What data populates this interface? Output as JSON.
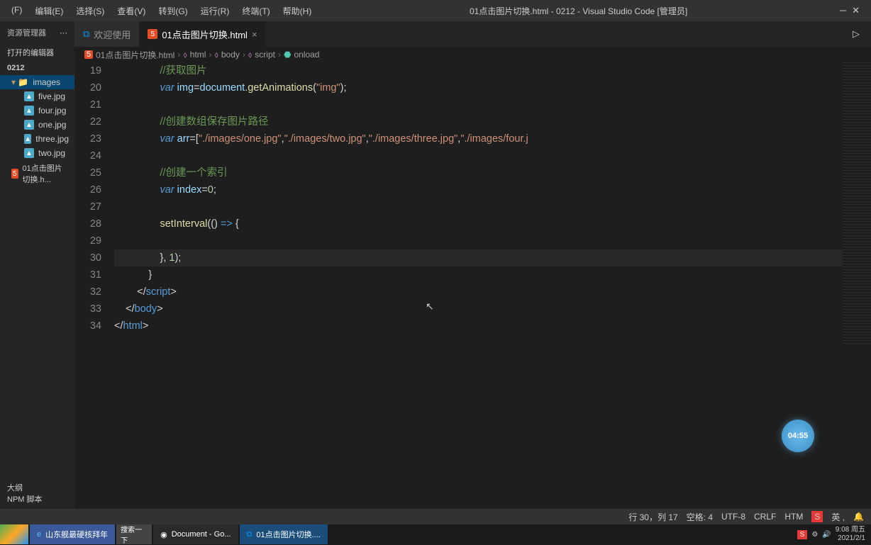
{
  "menubar": {
    "items": [
      "(F)",
      "编辑(E)",
      "选择(S)",
      "查看(V)",
      "转到(G)",
      "运行(R)",
      "终端(T)",
      "帮助(H)"
    ],
    "title": "01点击图片切换.html - 0212 - Visual Studio Code [管理员]"
  },
  "sidebar": {
    "header": "资源管理器",
    "section": "打开的编辑器",
    "root": "0212",
    "folder": "images",
    "files": [
      "five.jpg",
      "four.jpg",
      "one.jpg",
      "three.jpg",
      "two.jpg"
    ],
    "htmlFile": "01点击图片切换.h...",
    "bottom1": "大纲",
    "bottom2": "NPM 脚本"
  },
  "tabs": {
    "tab1": "欢迎使用",
    "tab2": "01点击图片切换.html"
  },
  "breadcrumb": {
    "file": "01点击图片切换.html",
    "path": [
      "html",
      "body",
      "script",
      "onload"
    ]
  },
  "code": {
    "startLine": 19,
    "lines": [
      {
        "n": 19,
        "indent": 4,
        "parts": [
          {
            "cls": "tok-cmt",
            "t": "//获取图片"
          }
        ]
      },
      {
        "n": 20,
        "indent": 4,
        "parts": [
          {
            "cls": "tok-kw",
            "t": "var"
          },
          {
            "cls": "",
            "t": " "
          },
          {
            "cls": "tok-var",
            "t": "img"
          },
          {
            "cls": "tok-op",
            "t": "="
          },
          {
            "cls": "tok-var",
            "t": "document"
          },
          {
            "cls": "tok-punct",
            "t": "."
          },
          {
            "cls": "tok-fn",
            "t": "getAnimations"
          },
          {
            "cls": "tok-punct",
            "t": "("
          },
          {
            "cls": "tok-str",
            "t": "\"img\""
          },
          {
            "cls": "tok-punct",
            "t": ");"
          }
        ]
      },
      {
        "n": 21,
        "indent": 4,
        "parts": []
      },
      {
        "n": 22,
        "indent": 4,
        "parts": [
          {
            "cls": "tok-cmt",
            "t": "//创建数组保存图片路径"
          }
        ]
      },
      {
        "n": 23,
        "indent": 4,
        "parts": [
          {
            "cls": "tok-kw",
            "t": "var"
          },
          {
            "cls": "",
            "t": " "
          },
          {
            "cls": "tok-var",
            "t": "arr"
          },
          {
            "cls": "tok-op",
            "t": "="
          },
          {
            "cls": "tok-punct",
            "t": "["
          },
          {
            "cls": "tok-str",
            "t": "\"./images/one.jpg\""
          },
          {
            "cls": "tok-punct",
            "t": ","
          },
          {
            "cls": "tok-str",
            "t": "\"./images/two.jpg\""
          },
          {
            "cls": "tok-punct",
            "t": ","
          },
          {
            "cls": "tok-str",
            "t": "\"./images/three.jpg\""
          },
          {
            "cls": "tok-punct",
            "t": ","
          },
          {
            "cls": "tok-str",
            "t": "\"./images/four.j"
          }
        ]
      },
      {
        "n": 24,
        "indent": 4,
        "parts": []
      },
      {
        "n": 25,
        "indent": 4,
        "parts": [
          {
            "cls": "tok-cmt",
            "t": "//创建一个索引"
          }
        ]
      },
      {
        "n": 26,
        "indent": 4,
        "parts": [
          {
            "cls": "tok-kw",
            "t": "var"
          },
          {
            "cls": "",
            "t": " "
          },
          {
            "cls": "tok-var",
            "t": "index"
          },
          {
            "cls": "tok-op",
            "t": "="
          },
          {
            "cls": "tok-num",
            "t": "0"
          },
          {
            "cls": "tok-punct",
            "t": ";"
          }
        ]
      },
      {
        "n": 27,
        "indent": 4,
        "parts": []
      },
      {
        "n": 28,
        "indent": 4,
        "parts": [
          {
            "cls": "tok-fn",
            "t": "setInterval"
          },
          {
            "cls": "tok-punct",
            "t": "(() "
          },
          {
            "cls": "tok-tag",
            "t": "=>"
          },
          {
            "cls": "tok-punct",
            "t": " {"
          }
        ]
      },
      {
        "n": 29,
        "indent": 5,
        "parts": []
      },
      {
        "n": 30,
        "indent": 4,
        "parts": [
          {
            "cls": "tok-punct",
            "t": "}, "
          },
          {
            "cls": "tok-num",
            "t": "1"
          },
          {
            "cls": "tok-punct",
            "t": ");"
          }
        ],
        "hl": true
      },
      {
        "n": 31,
        "indent": 3,
        "parts": [
          {
            "cls": "tok-punct",
            "t": "}"
          }
        ]
      },
      {
        "n": 32,
        "indent": 2,
        "parts": [
          {
            "cls": "tok-punct",
            "t": "</"
          },
          {
            "cls": "tok-tag",
            "t": "script"
          },
          {
            "cls": "tok-punct",
            "t": ">"
          }
        ]
      },
      {
        "n": 33,
        "indent": 1,
        "parts": [
          {
            "cls": "tok-punct",
            "t": "</"
          },
          {
            "cls": "tok-tag",
            "t": "body"
          },
          {
            "cls": "tok-punct",
            "t": ">"
          }
        ]
      },
      {
        "n": 34,
        "indent": 0,
        "parts": [
          {
            "cls": "tok-punct",
            "t": "</"
          },
          {
            "cls": "tok-tag",
            "t": "html"
          },
          {
            "cls": "tok-punct",
            "t": ">"
          }
        ]
      }
    ]
  },
  "timer": "04:55",
  "statusbar": {
    "position": "行 30，列 17",
    "spaces": "空格: 4",
    "encoding": "UTF-8",
    "eol": "CRLF",
    "lang": "HTM"
  },
  "taskbar": {
    "ie": "山东舰最硬核拜年",
    "search": "搜索一下",
    "chrome": "Document - Go...",
    "vscode": "01点击图片切换....",
    "clock_time": "9:08",
    "clock_day": "周五",
    "clock_date": "2021/2/1"
  }
}
